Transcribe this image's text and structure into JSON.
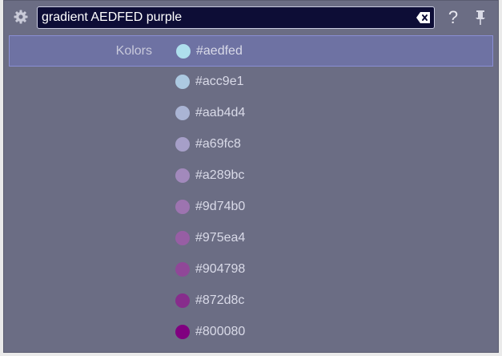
{
  "search": {
    "value": "gradient AEDFED purple"
  },
  "help_label": "?",
  "icons": {
    "settings": "gear-icon",
    "clear": "backspace-clear-icon",
    "pin": "pin-icon"
  },
  "colors": {
    "window_bg": "#6b6d84",
    "selected_bg": "#6e72a3",
    "search_bg": "#0d0d36"
  },
  "results": [
    {
      "label": "Kolors",
      "hex": "#aedfed",
      "color": "#aedfed",
      "selected": true
    },
    {
      "label": "",
      "hex": "#acc9e1",
      "color": "#acc9e1",
      "selected": false
    },
    {
      "label": "",
      "hex": "#aab4d4",
      "color": "#aab4d4",
      "selected": false
    },
    {
      "label": "",
      "hex": "#a69fc8",
      "color": "#a69fc8",
      "selected": false
    },
    {
      "label": "",
      "hex": "#a289bc",
      "color": "#a289bc",
      "selected": false
    },
    {
      "label": "",
      "hex": "#9d74b0",
      "color": "#9d74b0",
      "selected": false
    },
    {
      "label": "",
      "hex": "#975ea4",
      "color": "#975ea4",
      "selected": false
    },
    {
      "label": "",
      "hex": "#904798",
      "color": "#904798",
      "selected": false
    },
    {
      "label": "",
      "hex": "#872d8c",
      "color": "#872d8c",
      "selected": false
    },
    {
      "label": "",
      "hex": "#800080",
      "color": "#800080",
      "selected": false
    }
  ]
}
